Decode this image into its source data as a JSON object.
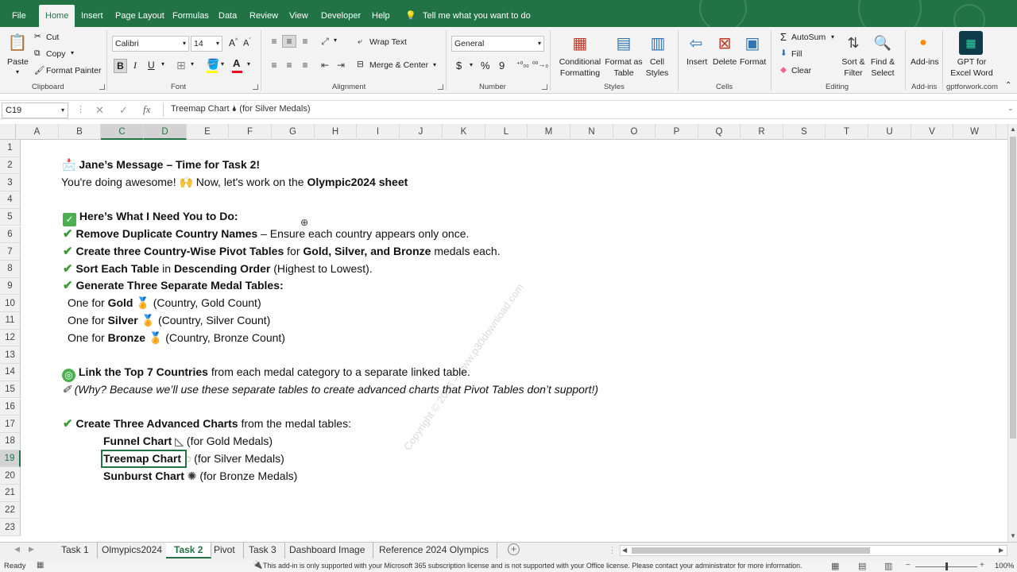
{
  "menu": {
    "items": [
      "File",
      "Home",
      "Insert",
      "Page Layout",
      "Formulas",
      "Data",
      "Review",
      "View",
      "Developer",
      "Help"
    ],
    "tell_me": "Tell me what you want to do"
  },
  "ribbon": {
    "clipboard": {
      "paste": "Paste",
      "cut": "Cut",
      "copy": "Copy",
      "format_painter": "Format Painter",
      "label": "Clipboard"
    },
    "font": {
      "name": "Calibri",
      "size": "14",
      "bold": "B",
      "italic": "I",
      "underline": "U",
      "label": "Font"
    },
    "alignment": {
      "wrap_text": "Wrap Text",
      "merge_center": "Merge & Center",
      "label": "Alignment"
    },
    "number": {
      "format": "General",
      "currency": "$",
      "percent": "%",
      "comma": "9",
      "label": "Number"
    },
    "styles": {
      "conditional_formatting": "Conditional Formatting",
      "format_as_table": "Format as Table",
      "cell_styles": "Cell Styles",
      "label": "Styles"
    },
    "cells": {
      "insert": "Insert",
      "delete": "Delete",
      "format": "Format",
      "label": "Cells"
    },
    "editing": {
      "autosum": "AutoSum",
      "fill": "Fill",
      "clear": "Clear",
      "sort_filter": "Sort & Filter",
      "find_select": "Find & Select",
      "label": "Editing"
    },
    "addins": {
      "addins": "Add-ins",
      "label": "Add-ins"
    },
    "gpt": {
      "name": "GPT for Excel Word",
      "label": "gptforwork.com"
    }
  },
  "formula_bar": {
    "name_box": "C19",
    "fx": "fx",
    "content": "Treemap Chart 🌢 (for Silver Medals)"
  },
  "columns": [
    "A",
    "B",
    "C",
    "D",
    "E",
    "F",
    "G",
    "H",
    "I",
    "J",
    "K",
    "L",
    "M",
    "N",
    "O",
    "P",
    "Q",
    "R",
    "S",
    "T",
    "U",
    "V",
    "W"
  ],
  "rows": [
    "1",
    "2",
    "3",
    "4",
    "5",
    "6",
    "7",
    "8",
    "9",
    "10",
    "11",
    "12",
    "13",
    "14",
    "15",
    "16",
    "17",
    "18",
    "19",
    "20",
    "21",
    "22",
    "23"
  ],
  "sheet": {
    "r2": {
      "icon": "📩",
      "text": "Jane’s Message – Time for Task 2!"
    },
    "r3": {
      "a": "You're doing awesome! ",
      "icon": "🙌",
      "b": " Now, let's work on the ",
      "c": "Olympic2024 sheet"
    },
    "r5": {
      "icon": "✓",
      "text": "Here’s What I Need You to Do:"
    },
    "r6": {
      "icon": "✔",
      "b": "Remove Duplicate Country Names",
      "t": " – Ensure each country appears only once."
    },
    "r7": {
      "icon": "✔",
      "b": "Create three Country-Wise Pivot Tables",
      "t": " for ",
      "b2": "Gold, Silver, and Bronze",
      "t2": " medals each."
    },
    "r8": {
      "icon": "✔",
      "b": "Sort Each Table",
      "t": " in ",
      "b2": "Descending Order",
      "t2": " (Highest to Lowest)."
    },
    "r9": {
      "icon": "✔",
      "b": "Generate Three Separate Medal Tables:"
    },
    "r10": {
      "t": "One for ",
      "b": "Gold",
      "icon": "🏅",
      "t2": " (Country, Gold Count)"
    },
    "r11": {
      "t": "One for ",
      "b": "Silver",
      "icon": "🏅",
      "t2": " (Country, Silver Count)"
    },
    "r12": {
      "t": "One for ",
      "b": "Bronze",
      "icon": "🏅",
      "t2": " (Country, Bronze Count)"
    },
    "r14": {
      "icon": "◎",
      "b": "Link the Top 7 Countries",
      "t": " from each medal category to a separate linked table."
    },
    "r15": {
      "icon": "✐",
      "t": "(Why? Because we’ll use these separate tables to create advanced charts that Pivot Tables don’t support!)"
    },
    "r17": {
      "icon": "✔",
      "b": "Create Three Advanced Charts",
      "t": " from the medal tables:"
    },
    "r18": {
      "b": "Funnel Chart",
      "icon": "◺",
      "t": " (for Gold Medals)"
    },
    "r19": {
      "b": "Treemap Chart",
      "icon": "◌",
      "t": " (for Silver Medals)"
    },
    "r20": {
      "b": "Sunburst Chart",
      "icon": "✺",
      "t": " (for Bronze Medals)"
    }
  },
  "watermark": "Copyright © 2025 – www.p30download.com",
  "tabs": [
    "Task 1",
    "Olmypics2024",
    "Task 2",
    "Pivot",
    "Task 3",
    "Dashboard Image",
    "Reference 2024 Olympics"
  ],
  "active_tab": "Task 2",
  "status": {
    "ready": "Ready",
    "message": "This add-in is only supported with your Microsoft 365 subscription license and is not supported with your Office license. Please contact your administrator for more information.",
    "zoom": "100%"
  },
  "colors": {
    "excel_green": "#217346",
    "check_green": "#3d9b35"
  }
}
